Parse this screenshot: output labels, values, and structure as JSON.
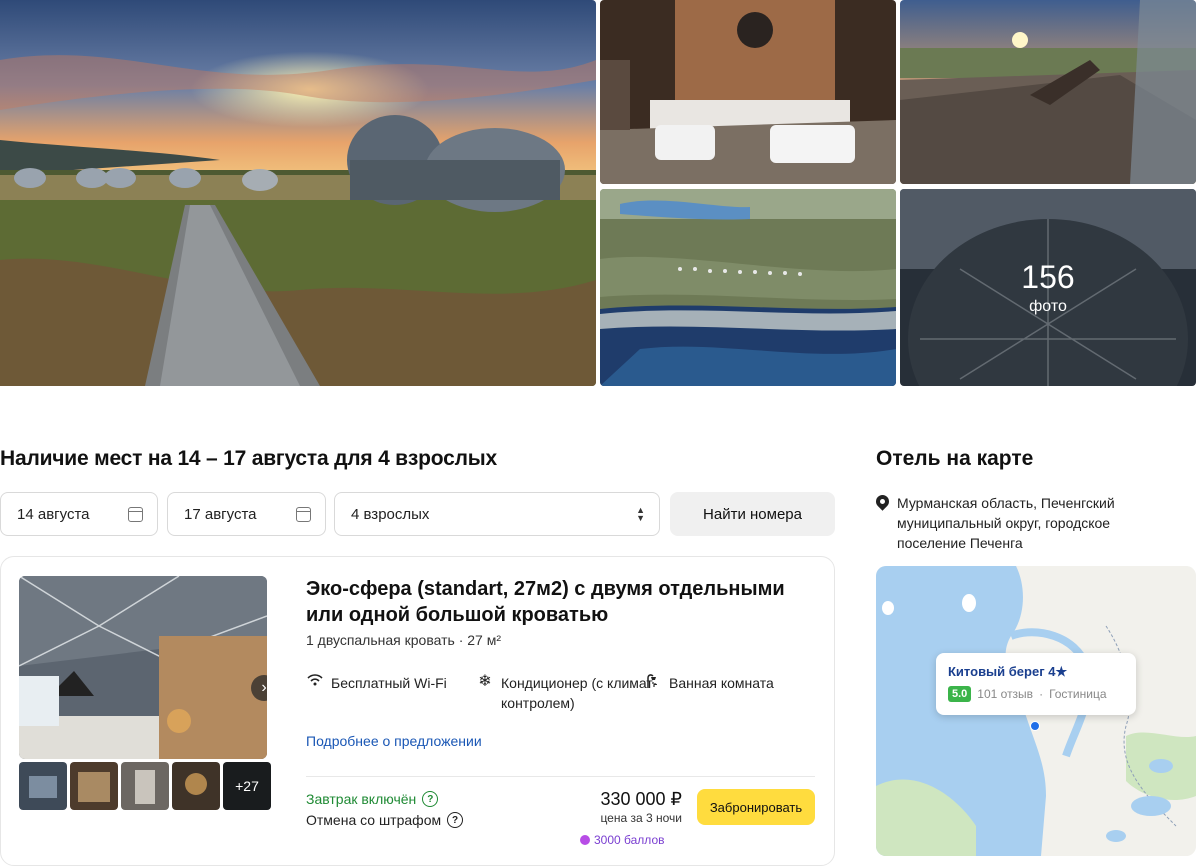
{
  "gallery": {
    "photo_count": "156",
    "photo_label": "фото"
  },
  "availability": {
    "title": "Наличие мест на 14 – 17 августа для 4 взрослых",
    "check_in": "14 августа",
    "check_out": "17 августа",
    "guests": "4 взрослых",
    "find_button": "Найти номера"
  },
  "room": {
    "title": "Эко-сфера (standart, 27м2) с двумя отдельными или одной большой кроватью",
    "bed": "1 двуспальная кровать",
    "area": "27 м²",
    "amenities": [
      {
        "icon": "wifi-icon",
        "label": "Бесплатный Wi-Fi"
      },
      {
        "icon": "snowflake-icon",
        "label": "Кондиционер (с климат-контролем)"
      },
      {
        "icon": "shower-icon",
        "label": "Ванная комната"
      }
    ],
    "details_link": "Подробнее о предложении",
    "more_photos": "+27",
    "breakfast": "Завтрак включён",
    "cancellation": "Отмена со штрафом",
    "price": "330 000 ₽",
    "price_note": "цена за 3 ночи",
    "bonus": "3000 баллов",
    "book_button": "Забронировать",
    "colors": {
      "breakfast": "#1f8a34",
      "book": "#ffdc3e",
      "link": "#1a57b5",
      "bonus": "#7a3fd1"
    }
  },
  "map_section": {
    "title": "Отель на карте",
    "address": "Мурманская область, Печенгский муниципальный округ, городское поселение Печенга",
    "hotel_name": "Китовый берег 4★",
    "rating": "5.0",
    "reviews": "101 отзыв",
    "type": "Гостиница"
  }
}
